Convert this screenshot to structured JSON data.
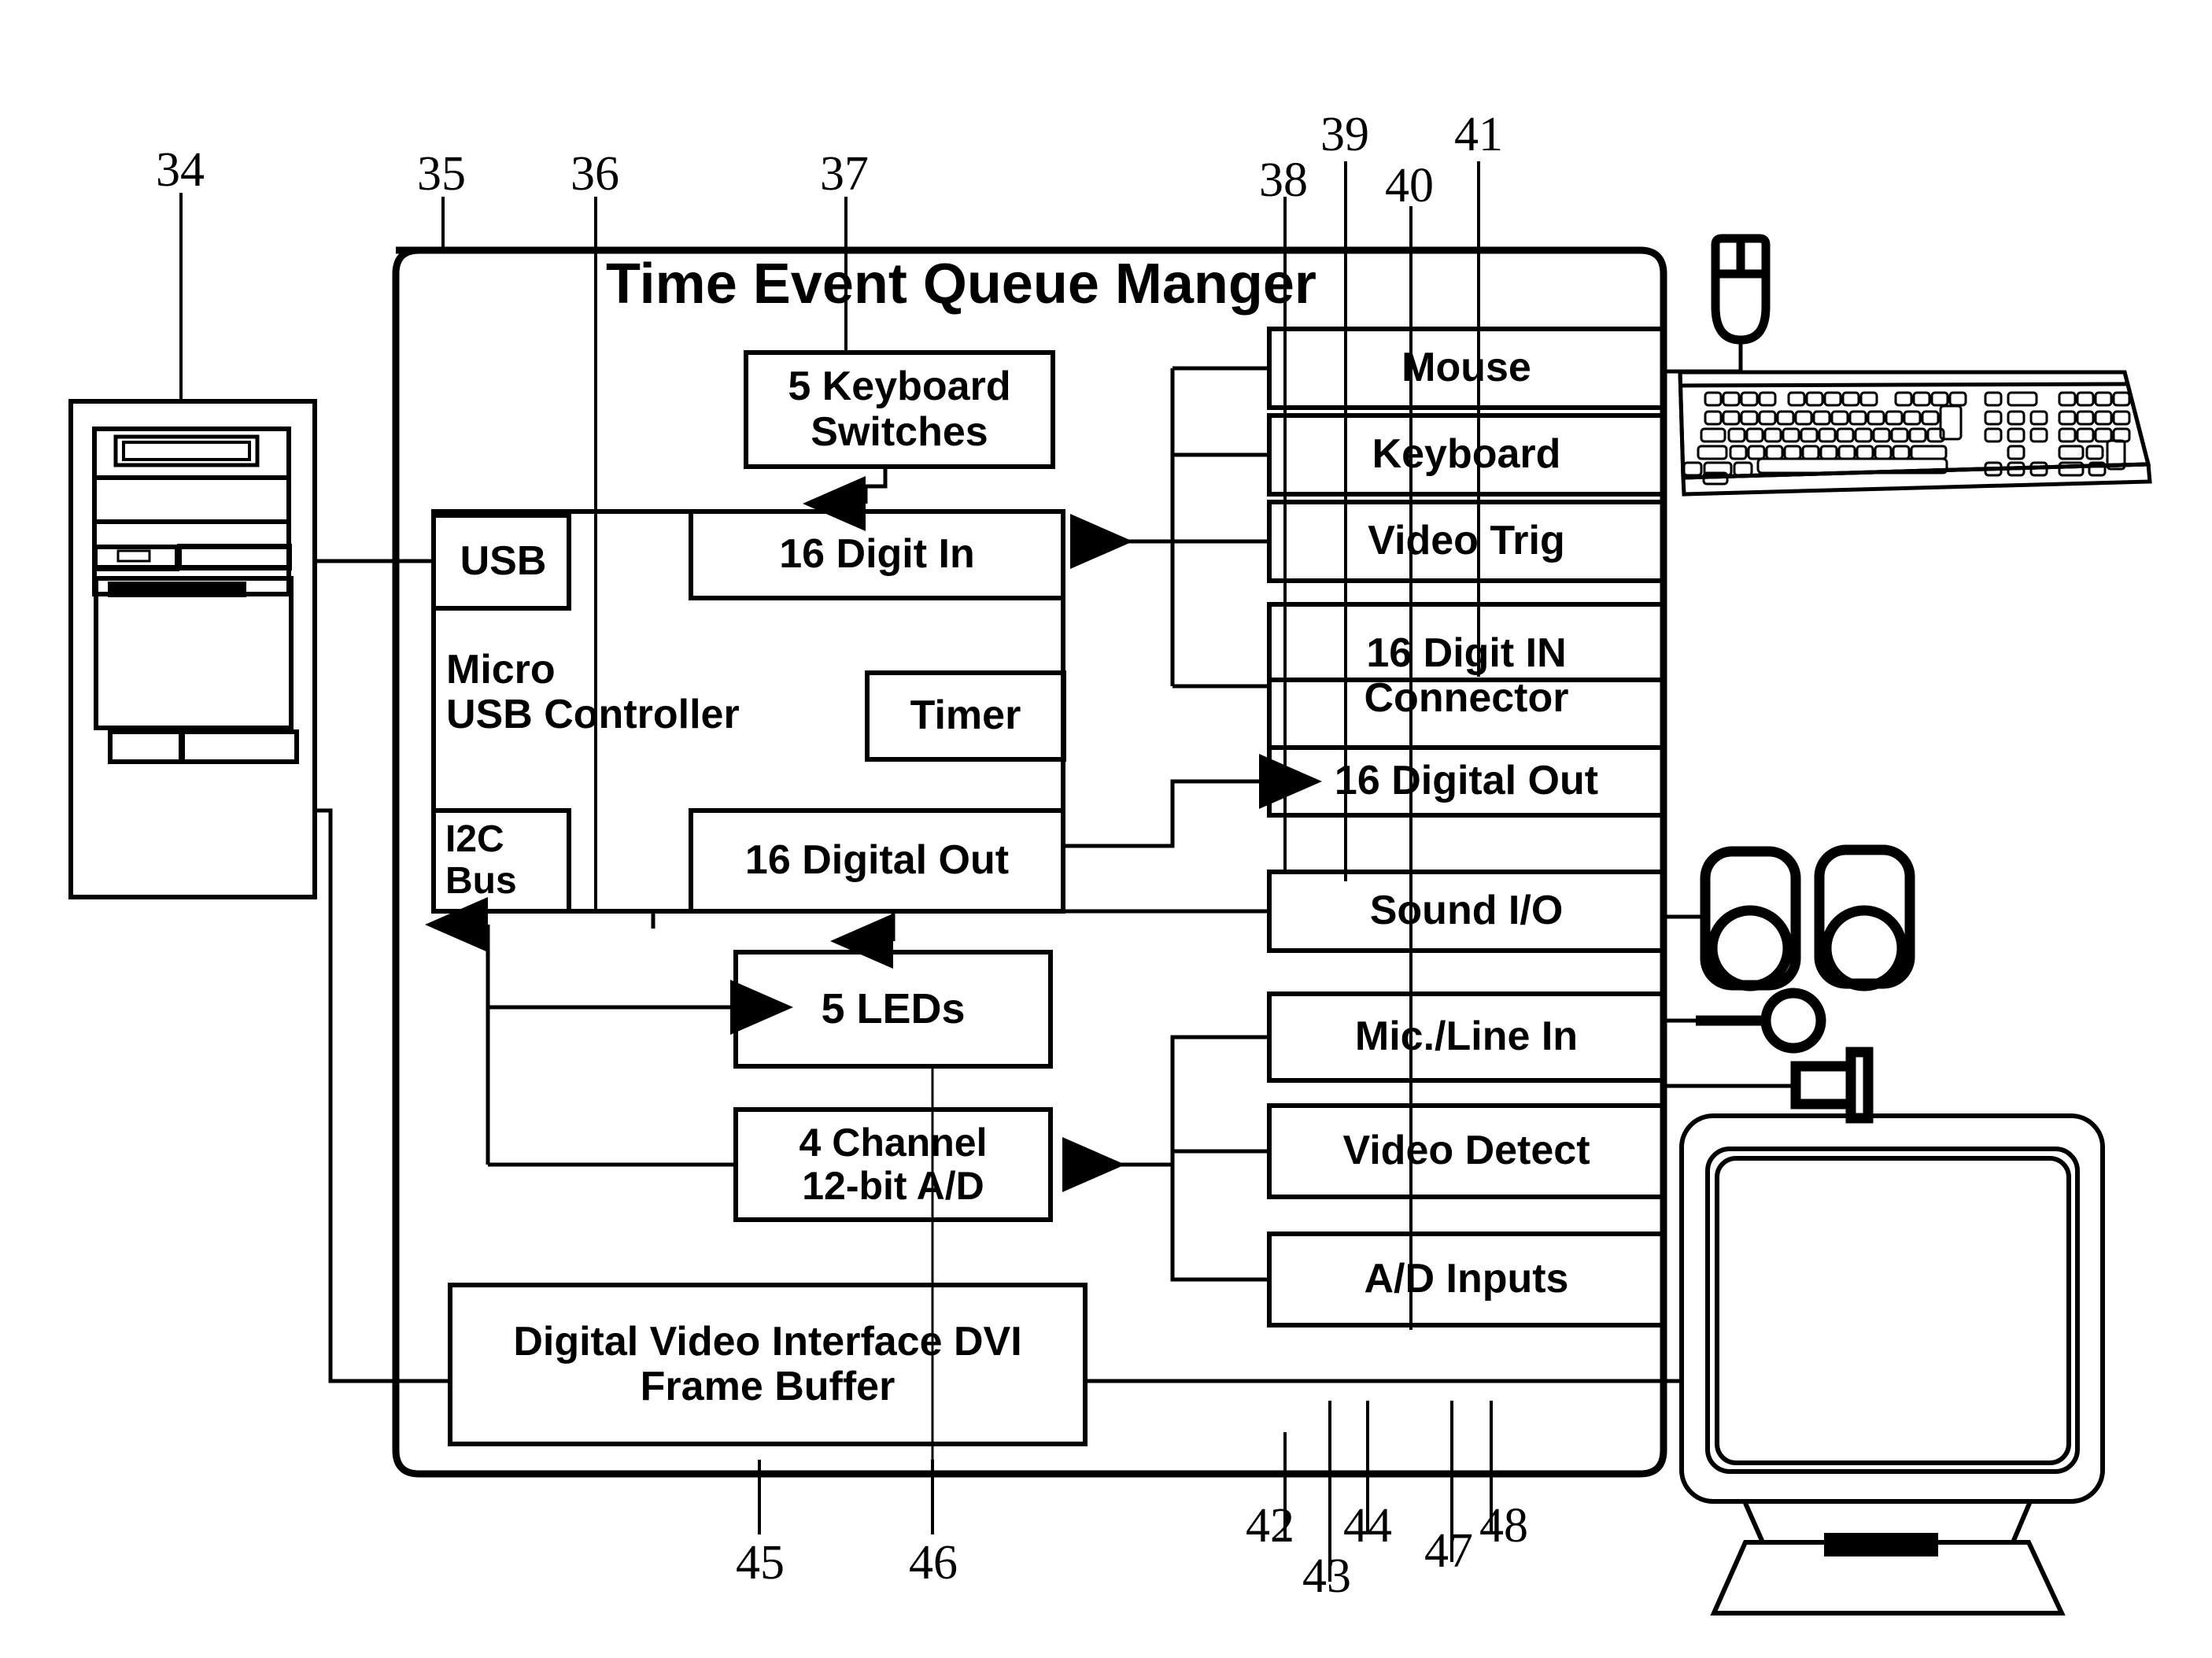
{
  "figure": {
    "title": "Time Event Queue Manger",
    "enclosure_label": "Time Event Queue Manger"
  },
  "blocks": {
    "keyboard_switches": "5 Keyboard\nSwitches",
    "usb": "USB",
    "micro_usb_controller": "Micro\nUSB Controller",
    "digit_in_16": "16 Digit In",
    "timer": "Timer",
    "i2c_bus": "I2C\nBus",
    "digital_out_16": "16 Digital Out",
    "leds": "5  LEDs",
    "ad_converter": "4 Channel\n12-bit A/D",
    "dvi_frame_buffer": "Digital Video Interface DVI\nFrame Buffer"
  },
  "connectors": {
    "mouse": "Mouse",
    "keyboard": "Keyboard",
    "video_trig": "Video  Trig",
    "digit_in_connector": "16 Digit IN\nConnector",
    "digital_out_16": "16 Digital Out",
    "sound_io": "Sound I/O",
    "mic_line_in": "Mic./Line In",
    "video_detect": "Video Detect",
    "ad_inputs": "A/D Inputs"
  },
  "reference_numbers": {
    "n34": "34",
    "n35": "35",
    "n36": "36",
    "n37": "37",
    "n38": "38",
    "n39": "39",
    "n40": "40",
    "n41": "41",
    "n42": "42",
    "n43": "43",
    "n44": "44",
    "n45": "45",
    "n46": "46",
    "n47": "47",
    "n48": "48"
  },
  "devices": {
    "pc_tower": "pc-tower",
    "mouse": "mouse",
    "keyboard": "keyboard",
    "speakers": "speakers",
    "microphone": "microphone",
    "video_plug": "video-plug",
    "monitor": "crt-monitor"
  },
  "colors": {
    "ink": "#000000",
    "paper": "#ffffff"
  }
}
